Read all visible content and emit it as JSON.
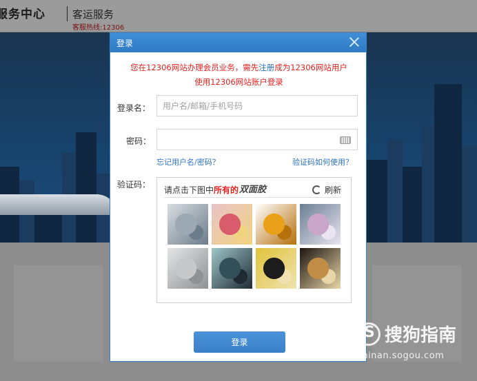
{
  "header": {
    "brand": "服务中心",
    "sub_brand": "客运服务",
    "hotline": "客服热线:12306"
  },
  "dialog": {
    "title": "登录",
    "notice_line1_before": "您在12306网站办理会员业务，需先",
    "notice_link": "注册",
    "notice_line1_after": "成为12306网站用户",
    "notice_line2": "使用12306网站账户登录",
    "username_label": "登录名：",
    "username_value": "",
    "username_placeholder": "用户名/邮箱/手机号码",
    "password_label": "密码：",
    "password_value": "",
    "forgot_link": "忘记用户名/密码？",
    "captcha_help_link": "验证码如何使用？",
    "captcha_label": "验证码：",
    "captcha_prompt_before": "请点击下图中",
    "captcha_prompt_highlight": "所有的",
    "captcha_target_word": "双面胶",
    "refresh_label": "刷新",
    "submit_label": "登录"
  },
  "captcha_images": [
    {
      "icon": "bearing-image",
      "colors": [
        "#d9dde1",
        "#9ca8b3",
        "#6b7c8a"
      ]
    },
    {
      "icon": "candy-pile-image",
      "colors": [
        "#e9c3c8",
        "#d85c6c",
        "#f0d37e"
      ]
    },
    {
      "icon": "orange-vase-image",
      "colors": [
        "#ffffff",
        "#e9a11a",
        "#b6700c"
      ]
    },
    {
      "icon": "coral-plant-image",
      "colors": [
        "#6a7f93",
        "#c9a6c8",
        "#e9e4f0"
      ]
    },
    {
      "icon": "tape-roll-image",
      "colors": [
        "#e4e4e4",
        "#c6c8c9",
        "#8d9296"
      ]
    },
    {
      "icon": "poster-image",
      "colors": [
        "#9ec6c8",
        "#33505a",
        "#1f2a33"
      ]
    },
    {
      "icon": "bicycle-poster-image",
      "colors": [
        "#e0c33a",
        "#1c1c1c",
        "#efe2b0"
      ]
    },
    {
      "icon": "dried-flower-image",
      "colors": [
        "#1c1410",
        "#c08c46",
        "#e8d6a8"
      ]
    }
  ],
  "watermark": {
    "cn": "搜狗指南",
    "url": "zhinan.sogou.com"
  },
  "colors": {
    "accent": "#3a86cf",
    "notice_red": "#e4231f",
    "link_blue": "#2c73c5"
  }
}
